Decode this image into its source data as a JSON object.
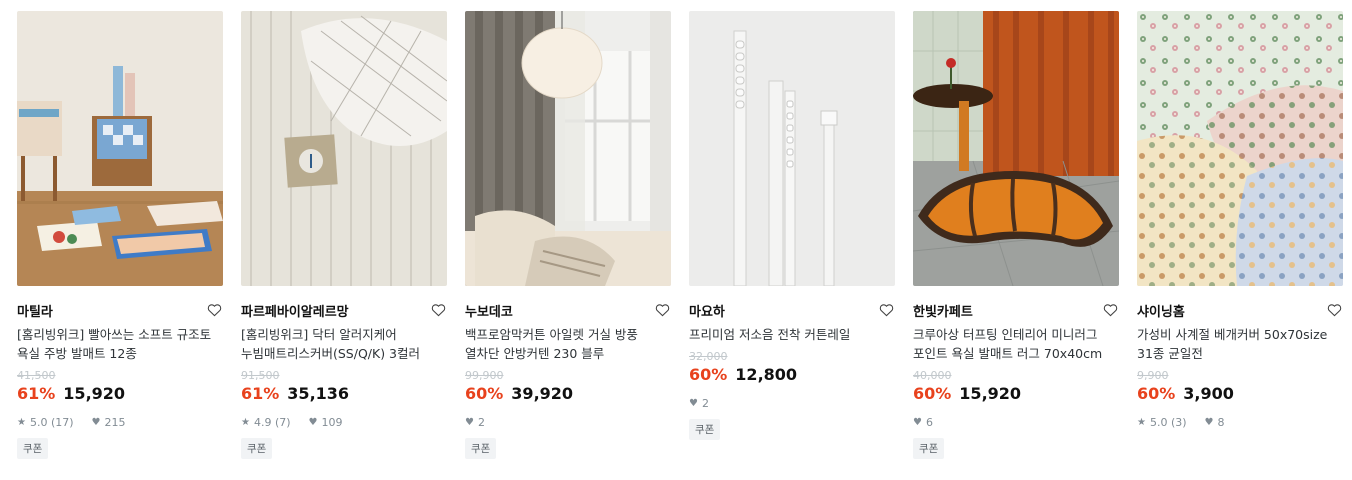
{
  "products": [
    {
      "brand": "마틸라",
      "title": "[홈리빙위크] 빨아쓰는 소프트 규조토 욕실 주방 발매트 12종",
      "original_price": "41,500",
      "discount": "61%",
      "price": "15,920",
      "rating": "5.0 (17)",
      "likes": "215",
      "badge": "쿠폰"
    },
    {
      "brand": "파르페바이알레르망",
      "title": "[홈리빙위크] 닥터 알러지케어 누빔매트리스커버(SS/Q/K) 3컬러",
      "original_price": "91,500",
      "discount": "61%",
      "price": "35,136",
      "rating": "4.9 (7)",
      "likes": "109",
      "badge": "쿠폰"
    },
    {
      "brand": "누보데코",
      "title": "백프로암막커튼 아일렛 거실 방풍 열차단 안방커텐 230 블루",
      "original_price": "99,900",
      "discount": "60%",
      "price": "39,920",
      "rating": "",
      "likes": "2",
      "badge": "쿠폰"
    },
    {
      "brand": "마요하",
      "title": "프리미엄 저소음 전착 커튼레일",
      "original_price": "32,000",
      "discount": "60%",
      "price": "12,800",
      "rating": "",
      "likes": "2",
      "badge": "쿠폰"
    },
    {
      "brand": "한빛카페트",
      "title": "크루아상 터프팅 인테리어 미니러그 포인트 욕실 발매트 러그 70x40cm",
      "original_price": "40,000",
      "discount": "60%",
      "price": "15,920",
      "rating": "",
      "likes": "6",
      "badge": "쿠폰"
    },
    {
      "brand": "샤이닝홈",
      "title": "가성비 사계절 베개커버 50x70size 31종 균일전",
      "original_price": "9,900",
      "discount": "60%",
      "price": "3,900",
      "rating": "5.0 (3)",
      "likes": "8",
      "badge": ""
    }
  ],
  "icons": {
    "wishlist": "heart-outline-icon",
    "rating": "star-icon",
    "likes": "heart-filled-icon"
  },
  "colors": {
    "discount": "#e8421d",
    "price": "#111111",
    "original_price": "#c2c8cc",
    "meta": "#828c94",
    "badge_bg": "#f1f3f5"
  }
}
